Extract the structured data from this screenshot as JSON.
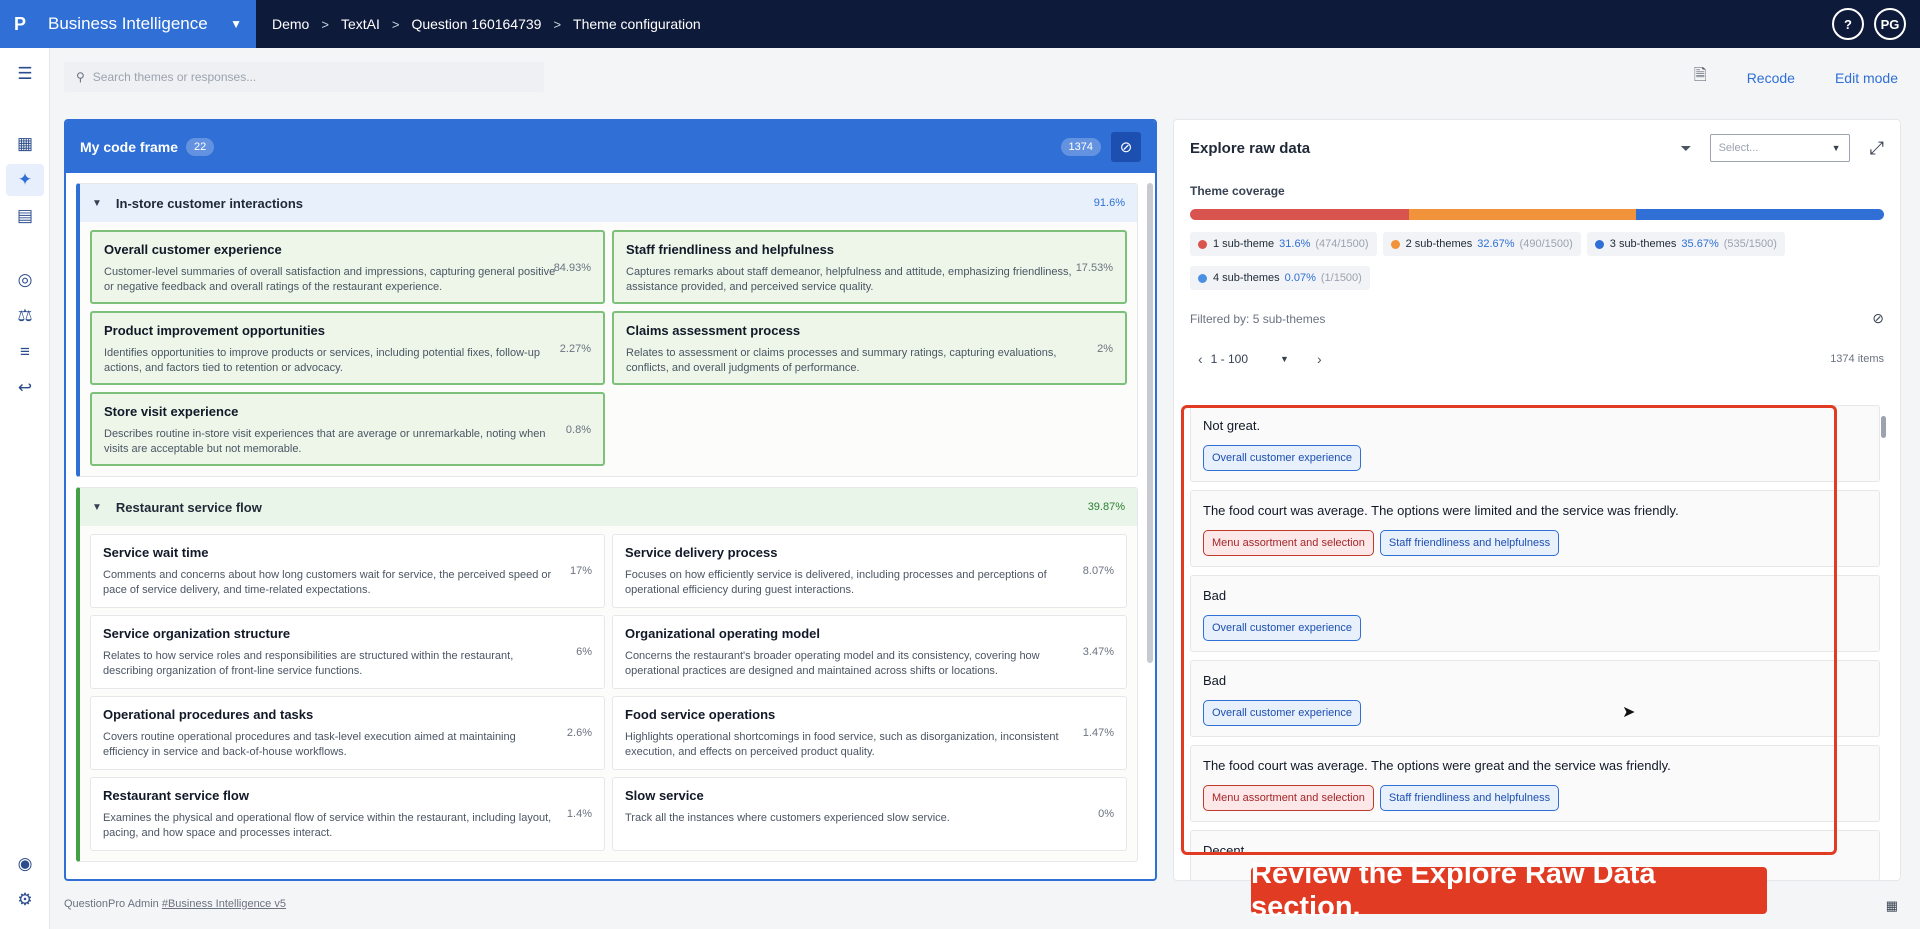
{
  "app": {
    "logo": "P",
    "name": "Business Intelligence"
  },
  "breadcrumbs": [
    "Demo",
    "TextAI",
    "Question 160164739",
    "Theme configuration"
  ],
  "user": {
    "help": "?",
    "initials": "PG"
  },
  "search": {
    "placeholder": "Search themes or responses..."
  },
  "toolbar": {
    "recode": "Recode",
    "edit_mode": "Edit mode"
  },
  "code_frame": {
    "title": "My code frame",
    "theme_count": "22",
    "total": "1374",
    "groups": [
      {
        "name": "In-store customer interactions",
        "pct": "91.6%",
        "cards": [
          {
            "title": "Overall customer experience",
            "desc": "Customer-level summaries of overall satisfaction and impressions, capturing general positive or negative feedback and overall ratings of the restaurant experience.",
            "pct": "84.93%"
          },
          {
            "title": "Staff friendliness and helpfulness",
            "desc": "Captures remarks about staff demeanor, helpfulness and attitude, emphasizing friendliness, assistance provided, and perceived service quality.",
            "pct": "17.53%"
          },
          {
            "title": "Product improvement opportunities",
            "desc": "Identifies opportunities to improve products or services, including potential fixes, follow-up actions, and factors tied to retention or advocacy.",
            "pct": "2.27%"
          },
          {
            "title": "Claims assessment process",
            "desc": "Relates to assessment or claims processes and summary ratings, capturing evaluations, conflicts, and overall judgments of performance.",
            "pct": "2%"
          },
          {
            "title": "Store visit experience",
            "desc": "Describes routine in-store visit experiences that are average or unremarkable, noting when visits are acceptable but not memorable.",
            "pct": "0.8%"
          }
        ]
      },
      {
        "name": "Restaurant service flow",
        "pct": "39.87%",
        "cards": [
          {
            "title": "Service wait time",
            "desc": "Comments and concerns about how long customers wait for service, the perceived speed or pace of service delivery, and time-related expectations.",
            "pct": "17%"
          },
          {
            "title": "Service delivery process",
            "desc": "Focuses on how efficiently service is delivered, including processes and perceptions of operational efficiency during guest interactions.",
            "pct": "8.07%"
          },
          {
            "title": "Service organization structure",
            "desc": "Relates to how service roles and responsibilities are structured within the restaurant, describing organization of front-line service functions.",
            "pct": "6%"
          },
          {
            "title": "Organizational operating model",
            "desc": "Concerns the restaurant's broader operating model and its consistency, covering how operational practices are designed and maintained across shifts or locations.",
            "pct": "3.47%"
          },
          {
            "title": "Operational procedures and tasks",
            "desc": "Covers routine operational procedures and task-level execution aimed at maintaining efficiency in service and back-of-house workflows.",
            "pct": "2.6%"
          },
          {
            "title": "Food service operations",
            "desc": "Highlights operational shortcomings in food service, such as disorganization, inconsistent execution, and effects on perceived product quality.",
            "pct": "1.47%"
          },
          {
            "title": "Restaurant service flow",
            "desc": "Examines the physical and operational flow of service within the restaurant, including layout, pacing, and how space and processes interact.",
            "pct": "1.4%"
          },
          {
            "title": "Slow service",
            "desc": "Track all the instances where customers experienced slow service.",
            "pct": "0%"
          }
        ]
      }
    ]
  },
  "explore": {
    "title": "Explore raw data",
    "select_placeholder": "Select...",
    "coverage_label": "Theme coverage",
    "coverage": [
      {
        "label": "1 sub-theme",
        "pct": "31.6%",
        "count": "(474/1500)",
        "color": "#d9534f",
        "share": 31.6
      },
      {
        "label": "2 sub-themes",
        "pct": "32.67%",
        "count": "(490/1500)",
        "color": "#f0933a",
        "share": 32.67
      },
      {
        "label": "3 sub-themes",
        "pct": "35.67%",
        "count": "(535/1500)",
        "color": "#2f6fd6",
        "share": 35.67
      },
      {
        "label": "4 sub-themes",
        "pct": "0.07%",
        "count": "(1/1500)",
        "color": "#4a90e2",
        "share": 0.07
      }
    ],
    "filtered_by": "Filtered by: 5 sub-themes",
    "page_range": "1 - 100",
    "items_count": "1374 items",
    "responses": [
      {
        "text": "Not great.",
        "tags": [
          {
            "label": "Overall customer experience",
            "kind": "blue"
          }
        ]
      },
      {
        "text": "The food court was average. The options were limited and the service was friendly.",
        "tags": [
          {
            "label": "Menu assortment and selection",
            "kind": "red"
          },
          {
            "label": "Staff friendliness and helpfulness",
            "kind": "blue"
          }
        ]
      },
      {
        "text": "Bad",
        "tags": [
          {
            "label": "Overall customer experience",
            "kind": "blue"
          }
        ]
      },
      {
        "text": "Bad",
        "tags": [
          {
            "label": "Overall customer experience",
            "kind": "blue"
          }
        ]
      },
      {
        "text": "The food court was average. The options were great and the service was friendly.",
        "tags": [
          {
            "label": "Menu assortment and selection",
            "kind": "red"
          },
          {
            "label": "Staff friendliness and helpfulness",
            "kind": "blue"
          }
        ]
      },
      {
        "text": "Decent",
        "tags": []
      }
    ]
  },
  "footer": {
    "prefix": "QuestionPro Admin",
    "link": "#Business Intelligence v5"
  },
  "caption": "Review the Explore Raw Data section."
}
